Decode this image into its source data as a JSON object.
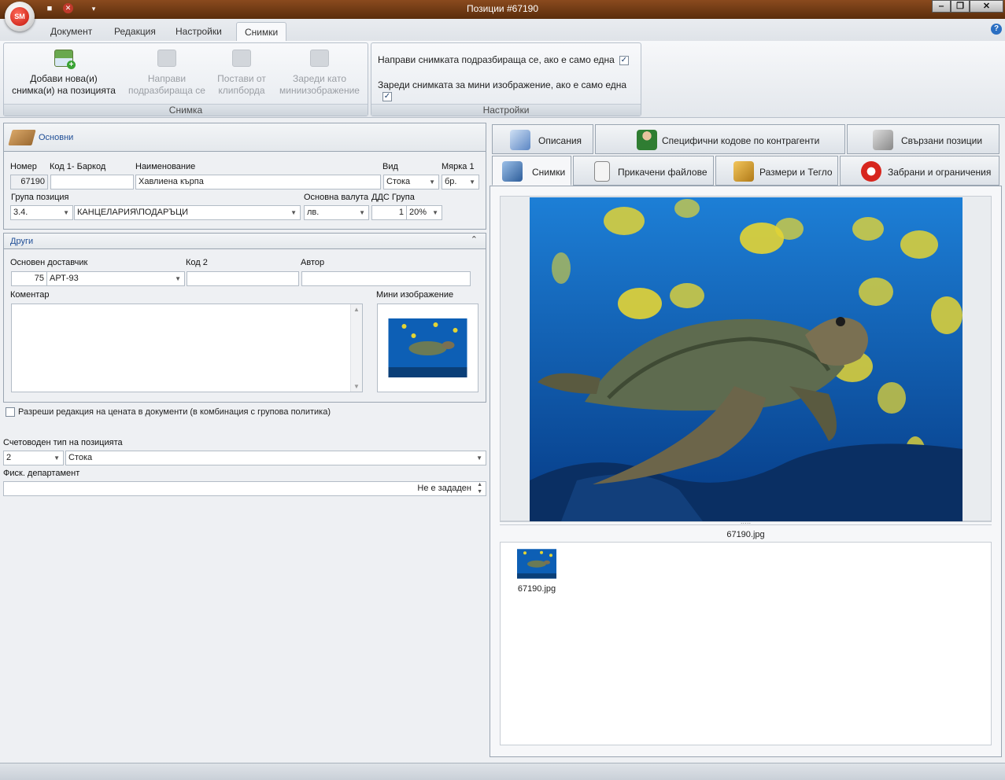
{
  "window": {
    "title": "Позиции #67190",
    "app_logo": "SM"
  },
  "quick_access": {
    "save_icon": "floppy-disk-icon",
    "close_icon": "red-x-icon",
    "dropdown_icon": "chevron-down-icon"
  },
  "window_buttons": {
    "minimize": "‒",
    "restore": "❐",
    "close": "✕"
  },
  "ribbon_tabs": [
    "Документ",
    "Редакция",
    "Настройки",
    "Снимки"
  ],
  "help_label": "?",
  "ribbon": {
    "snimka_group": {
      "caption": "Снимка",
      "buttons": [
        {
          "line1": "Добави нова(и)",
          "line2": "снимка(и) на позицията"
        },
        {
          "line1": "Направи",
          "line2": "подразбираща се"
        },
        {
          "line1": "Постави от",
          "line2": "клипборда"
        },
        {
          "line1": "Зареди като",
          "line2": "миниизображение"
        }
      ]
    },
    "settings_group": {
      "caption": "Настройки",
      "check1": "Направи снимката подразбираща се, ако е само една",
      "check2": "Зареди снимката за мини изображение, ако е само една",
      "check_mark": "✓"
    }
  },
  "basics": {
    "header": "Основни",
    "labels": {
      "number": "Номер",
      "barcode": "Код 1- Баркод",
      "name": "Наименование",
      "kind": "Вид",
      "unit": "Мярка 1",
      "group": "Група позиция",
      "currency": "Основна валута",
      "vat": "ДДС Група"
    },
    "values": {
      "number": "67190",
      "barcode": "",
      "name": "Хавлиена кърпа",
      "kind": "Стока",
      "unit": "бр.",
      "group_code": "3.4.",
      "group_name": "КАНЦЕЛАРИЯ\\ПОДАРЪЦИ",
      "currency": "лв.",
      "vat_code": "1",
      "vat_rate": "20%"
    }
  },
  "others": {
    "header": "Други",
    "labels": {
      "supplier": "Основен доставчик",
      "code2": "Код 2",
      "author": "Автор",
      "comment": "Коментар",
      "thumb": "Мини изображение"
    },
    "values": {
      "supplier_id": "75",
      "supplier_name": "АРТ-93",
      "code2": "",
      "author": "",
      "comment": ""
    }
  },
  "allow_price_edit": "Разреши редакция на цената в документи (в комбинация с групова политика)",
  "accounting": {
    "label": "Счетоводен тип на позицията",
    "code": "2",
    "name": "Стока"
  },
  "fiscal": {
    "label": "Фиск. департамент",
    "value": "Не е зададен"
  },
  "right_tabs_row1": [
    "Описания",
    "Специфични кодове по контрагенти",
    "Свързани позиции"
  ],
  "right_tabs_row2": [
    "Снимки",
    "Прикачени файлове",
    "Размери и Тегло",
    "Забрани и ограничения"
  ],
  "images": {
    "main_caption": "67190.jpg",
    "list": [
      {
        "file": "67190.jpg"
      }
    ]
  },
  "colors": {
    "titlebar": "#6b3512",
    "accent_link": "#1f4e96",
    "water": "#0d5fb5",
    "fish": "#e3d434"
  }
}
